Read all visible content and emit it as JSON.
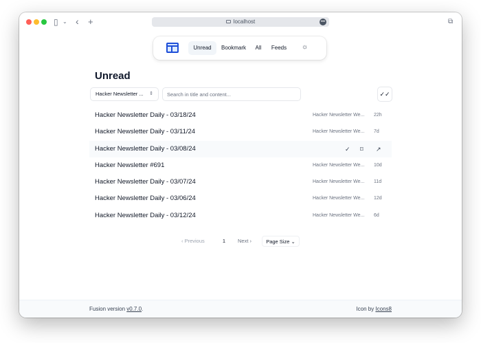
{
  "browser": {
    "url": "localhost"
  },
  "nav": {
    "items": [
      "Unread",
      "Bookmark",
      "All",
      "Feeds"
    ],
    "active": "Unread"
  },
  "page": {
    "title": "Unread"
  },
  "filters": {
    "feed_select": "Hacker Newsletter ...",
    "search_placeholder": "Search in title and content..."
  },
  "items": [
    {
      "title": "Hacker Newsletter Daily - 03/18/24",
      "feed": "Hacker Newsletter We...",
      "age": "22h"
    },
    {
      "title": "Hacker Newsletter Daily - 03/11/24",
      "feed": "Hacker Newsletter We...",
      "age": "7d"
    },
    {
      "title": "Hacker Newsletter Daily - 03/08/24",
      "feed": "",
      "age": ""
    },
    {
      "title": "Hacker Newsletter #691",
      "feed": "Hacker Newsletter We...",
      "age": "10d"
    },
    {
      "title": "Hacker Newsletter Daily - 03/07/24",
      "feed": "Hacker Newsletter We...",
      "age": "11d"
    },
    {
      "title": "Hacker Newsletter Daily - 03/06/24",
      "feed": "Hacker Newsletter We...",
      "age": "12d"
    },
    {
      "title": "Hacker Newsletter Daily - 03/12/24",
      "feed": "Hacker Newsletter We...",
      "age": "6d"
    }
  ],
  "pagination": {
    "prev": "Previous",
    "page": "1",
    "next": "Next",
    "page_size": "Page Size"
  },
  "footer": {
    "version_prefix": "Fusion version ",
    "version": "v0.7.0",
    "version_suffix": ".",
    "icon_prefix": "Icon by ",
    "icon_link": "Icons8"
  }
}
